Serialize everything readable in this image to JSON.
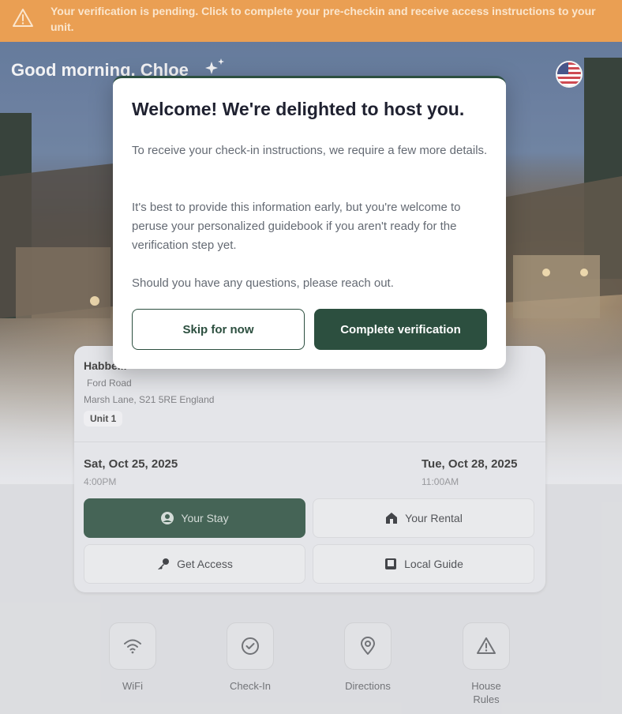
{
  "banner": {
    "icon": "warning-icon",
    "text": "Your verification is pending. Click to complete your pre-checkin and receive access instructions to your unit.",
    "color": "#e8923c"
  },
  "header": {
    "greeting": "Good morning, Chloe",
    "sparkle_icon": "sparkle-icon",
    "language_icon": "us-flag-icon"
  },
  "property": {
    "name": "Habbe...",
    "address_line1": "Ford Road",
    "address_line2": "Marsh Lane, S21 5RE England",
    "unit": "Unit 1"
  },
  "stay": {
    "check_in_date": "Sat, Oct 25, 2025",
    "check_in_time": "4:00PM",
    "check_out_date": "Tue, Oct 28, 2025",
    "check_out_time": "11:00AM"
  },
  "tiles": [
    {
      "label": "Your Stay",
      "icon": "user-circle-icon",
      "active": true
    },
    {
      "label": "Your Rental",
      "icon": "house-icon",
      "active": false
    },
    {
      "label": "Get Access",
      "icon": "key-icon",
      "active": false
    },
    {
      "label": "Local Guide",
      "icon": "book-icon",
      "active": false
    }
  ],
  "quick_links": [
    {
      "label": "WiFi",
      "icon": "wifi-icon"
    },
    {
      "label": "Check-In",
      "icon": "check-circle-icon"
    },
    {
      "label": "Directions",
      "icon": "map-pin-icon"
    },
    {
      "label": "House Rules",
      "icon": "alert-triangle-icon"
    }
  ],
  "modal": {
    "title": "Welcome! We're delighted to host you.",
    "paragraph1": "To receive your check-in instructions, we require a few more details.",
    "paragraph2": "It's best to provide this information early, but you're welcome to peruse your personalized guidebook if you aren't ready for the verification step yet.",
    "paragraph3": "Should you have any questions, please reach out.",
    "skip_label": "Skip for now",
    "complete_label": "Complete verification"
  },
  "colors": {
    "accent": "#2c4f3f",
    "banner": "#e8923c"
  }
}
